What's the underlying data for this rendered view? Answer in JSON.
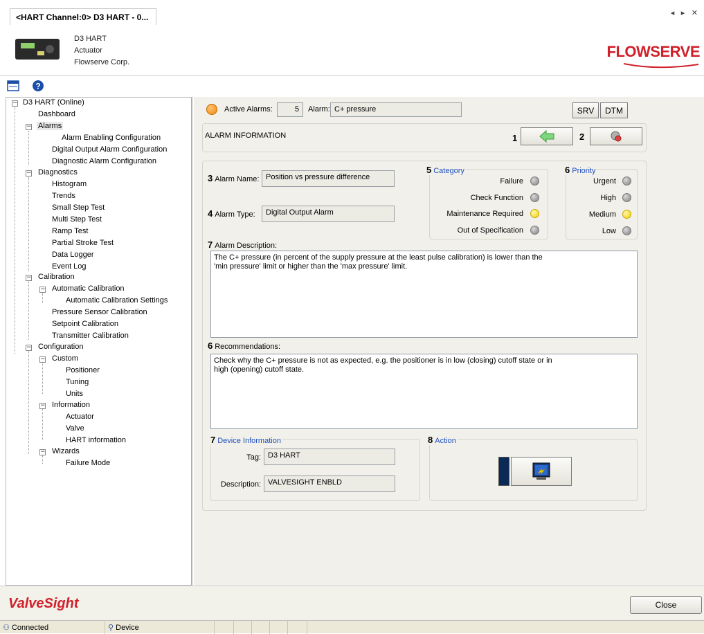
{
  "tab": {
    "title": "<HART Channel:0> D3 HART - 0..."
  },
  "device": {
    "name": "D3 HART",
    "type": "Actuator",
    "vendor": "Flowserve Corp.",
    "logo_text": "FLOWSERVE"
  },
  "tree": {
    "items": [
      "D3 HART (Online)",
      "Dashboard",
      "Alarms",
      "Alarm Enabling Configuration",
      "Digital Output Alarm Configuration",
      "Diagnostic Alarm Configuration",
      "Diagnostics",
      "Histogram",
      "Trends",
      "Small Step Test",
      "Multi Step Test",
      "Ramp Test",
      "Partial Stroke Test",
      "Data Logger",
      "Event Log",
      "Calibration",
      "Automatic Calibration",
      "Automatic Calibration Settings",
      "Pressure Sensor Calibration",
      "Setpoint Calibration",
      "Transmitter Calibration",
      "Configuration",
      "Custom",
      "Positioner",
      "Tuning",
      "Units",
      "Information",
      "Actuator",
      "Valve",
      "HART information",
      "Wizards",
      "Failure Mode"
    ]
  },
  "top": {
    "active_alarms_label": "Active Alarms:",
    "active_alarms_count": "5",
    "alarm_label": "Alarm:",
    "alarm_value": "C+ pressure",
    "srv_label": "SRV",
    "dtm_label": "DTM"
  },
  "alarm_info": {
    "title": "ALARM INFORMATION",
    "nav_num_1": "1",
    "nav_num_2": "2"
  },
  "details": {
    "name_num": "3",
    "name_label": "Alarm Name:",
    "name_value": "Position vs pressure difference",
    "type_num": "4",
    "type_label": "Alarm Type:",
    "type_value": "Digital Output Alarm",
    "desc_num": "7",
    "desc_label": "Alarm Description:",
    "desc_value": "The C+ pressure (in percent of the supply pressure at the least pulse calibration) is lower than the\n'min pressure' limit or higher than the 'max pressure' limit.",
    "rec_num": "6",
    "rec_label": "Recommendations:",
    "rec_value": "Check why the C+ pressure is not as expected, e.g. the positioner is in low (closing) cutoff state or in\nhigh (opening) cutoff state."
  },
  "category": {
    "num": "5",
    "title": "Category",
    "items": [
      "Failure",
      "Check Function",
      "Maintenance Required",
      "Out of Specification"
    ],
    "active": [
      false,
      false,
      true,
      false
    ]
  },
  "priority": {
    "num": "6",
    "title": "Priority",
    "items": [
      "Urgent",
      "High",
      "Medium",
      "Low"
    ],
    "active": [
      false,
      false,
      true,
      false
    ]
  },
  "device_info": {
    "num": "7",
    "title": "Device Information",
    "tag_label": "Tag:",
    "tag_value": "D3 HART",
    "desc_label": "Description:",
    "desc_value": "VALVESIGHT ENBLD"
  },
  "action": {
    "num": "8",
    "title": "Action"
  },
  "footer": {
    "brand": "ValveSight",
    "close_label": "Close"
  },
  "status": {
    "connection": "Connected",
    "device": "Device"
  },
  "colors": {
    "brand_red": "#d0202a",
    "group_title_blue": "#1f4fbf",
    "led_active": "#f0d000",
    "alarm_orange": "#f08a10"
  }
}
